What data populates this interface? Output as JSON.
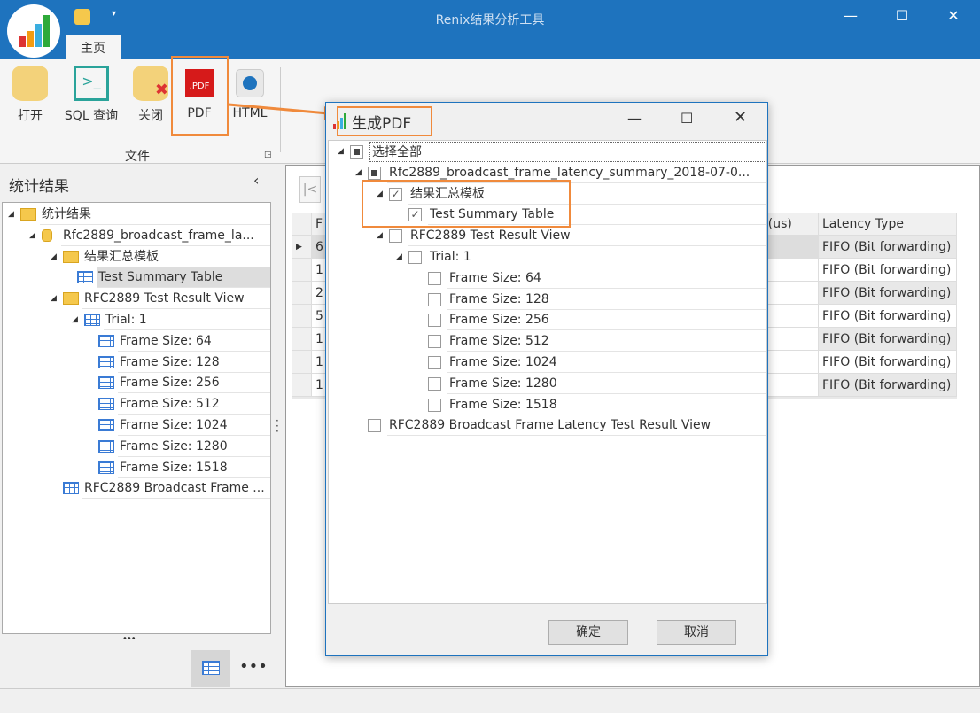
{
  "app": {
    "title": "Renix结果分析工具",
    "tab": "主页",
    "accent": "#1e73be",
    "highlight": "#f08a3c"
  },
  "ribbon": {
    "buttons": [
      "打开",
      "SQL 查询",
      "关闭",
      "PDF",
      "HTML"
    ],
    "group": "文件"
  },
  "left_panel": {
    "title": "统计结果",
    "tree": [
      {
        "label": "统计结果",
        "level": 0,
        "icon": "folder-table-icon"
      },
      {
        "label": "Rfc2889_broadcast_frame_la...",
        "level": 1,
        "icon": "database-icon"
      },
      {
        "label": "结果汇总模板",
        "level": 2,
        "icon": "folder-icon"
      },
      {
        "label": "Test Summary Table",
        "level": 3,
        "icon": "table-icon"
      },
      {
        "label": "RFC2889 Test Result View",
        "level": 2,
        "icon": "folder-table-icon"
      },
      {
        "label": "Trial: 1",
        "level": 3,
        "icon": "table-icon"
      },
      {
        "label": "Frame Size: 64",
        "level": 4,
        "icon": "table-icon"
      },
      {
        "label": "Frame Size: 128",
        "level": 4,
        "icon": "table-icon"
      },
      {
        "label": "Frame Size: 256",
        "level": 4,
        "icon": "table-icon"
      },
      {
        "label": "Frame Size: 512",
        "level": 4,
        "icon": "table-icon"
      },
      {
        "label": "Frame Size: 1024",
        "level": 4,
        "icon": "table-icon"
      },
      {
        "label": "Frame Size: 1280",
        "level": 4,
        "icon": "table-icon"
      },
      {
        "label": "Frame Size: 1518",
        "level": 4,
        "icon": "table-icon"
      },
      {
        "label": "RFC2889 Broadcast Frame ...",
        "level": 2,
        "icon": "table-icon"
      }
    ],
    "more": "•••"
  },
  "grid": {
    "nav_first": "|<",
    "headers": [
      "F",
      "y (us)",
      "Latency Type"
    ],
    "first_col": [
      "6",
      "1",
      "2",
      "5",
      "1",
      "1",
      "1"
    ],
    "latency_type": [
      "FIFO (Bit forwarding)",
      "FIFO (Bit forwarding)",
      "FIFO (Bit forwarding)",
      "FIFO (Bit forwarding)",
      "FIFO (Bit forwarding)",
      "FIFO (Bit forwarding)",
      "FIFO (Bit forwarding)"
    ]
  },
  "dialog": {
    "title": "生成PDF",
    "ok": "确定",
    "cancel": "取消",
    "tree": [
      {
        "label": "选择全部",
        "level": 0,
        "state": "indeterminate",
        "expand": true
      },
      {
        "label": "Rfc2889_broadcast_frame_latency_summary_2018-07-0...",
        "level": 1,
        "state": "indeterminate",
        "expand": true
      },
      {
        "label": "结果汇总模板",
        "level": 2,
        "state": "checked",
        "expand": true
      },
      {
        "label": "Test Summary Table",
        "level": 3,
        "state": "checked",
        "expand": false
      },
      {
        "label": "RFC2889 Test Result View",
        "level": 2,
        "state": "unchecked",
        "expand": true
      },
      {
        "label": "Trial: 1",
        "level": 3,
        "state": "unchecked",
        "expand": true
      },
      {
        "label": "Frame Size: 64",
        "level": 4,
        "state": "unchecked",
        "expand": false
      },
      {
        "label": "Frame Size: 128",
        "level": 4,
        "state": "unchecked",
        "expand": false
      },
      {
        "label": "Frame Size: 256",
        "level": 4,
        "state": "unchecked",
        "expand": false
      },
      {
        "label": "Frame Size: 512",
        "level": 4,
        "state": "unchecked",
        "expand": false
      },
      {
        "label": "Frame Size: 1024",
        "level": 4,
        "state": "unchecked",
        "expand": false
      },
      {
        "label": "Frame Size: 1280",
        "level": 4,
        "state": "unchecked",
        "expand": false
      },
      {
        "label": "Frame Size: 1518",
        "level": 4,
        "state": "unchecked",
        "expand": false
      },
      {
        "label": "RFC2889 Broadcast Frame Latency Test Result View",
        "level": 1,
        "state": "unchecked",
        "expand": false
      }
    ]
  }
}
